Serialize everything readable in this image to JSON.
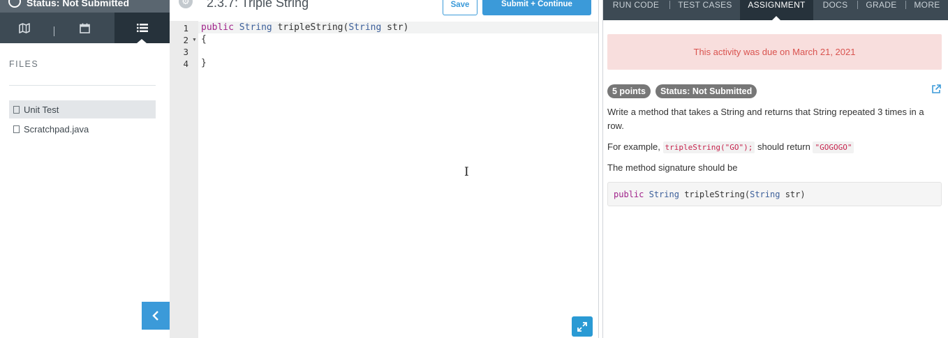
{
  "sidebar": {
    "status_text": "Status: Not Submitted",
    "nav": {
      "map_icon": "map-icon",
      "calendar_icon": "calendar-icon",
      "list_icon": "list-icon"
    },
    "files_label": "FILES",
    "files": [
      {
        "name": "Unit Test",
        "selected": true
      },
      {
        "name": "Scratchpad.java",
        "selected": false
      }
    ],
    "collapse_icon": "chevron-left-icon"
  },
  "editor": {
    "title": "2.3.7: Triple String",
    "save_label": "Save",
    "submit_label": "Submit + Continue",
    "line_numbers": [
      "1",
      "2",
      "3",
      "4"
    ],
    "code": {
      "line1_keyword": "public",
      "line1_type": "String",
      "line1_name": "tripleString(",
      "line1_param_type": "String",
      "line1_rest": "str)",
      "line2": "{",
      "line3": "",
      "line4": "}"
    }
  },
  "panel": {
    "tabs": [
      {
        "label": "RUN CODE",
        "active": false
      },
      {
        "label": "TEST CASES",
        "active": false
      },
      {
        "label": "ASSIGNMENT",
        "active": true
      },
      {
        "label": "DOCS",
        "active": false
      },
      {
        "label": "GRADE",
        "active": false
      },
      {
        "label": "MORE",
        "active": false
      }
    ],
    "alert": "This activity was due on March 21, 2021",
    "points_badge": "5 points",
    "status_badge": "Status: Not Submitted",
    "description": "Write a method that takes a String and returns that String repeated 3 times in a row.",
    "example_prefix": "For example,",
    "example_call": "tripleString(\"GO\");",
    "example_mid": "should return",
    "example_result": "\"GOGOGO\"",
    "signature_intro": "The method signature should be",
    "signature": {
      "keyword": "public",
      "type": "String",
      "name": "tripleString(",
      "param_type": "String",
      "rest": "str)"
    }
  },
  "colors": {
    "accent": "#3b9ad9",
    "nav_bg": "#3d4a54",
    "nav_active": "#26323b",
    "alert_bg": "#f8dedd",
    "alert_text": "#d9534f",
    "badge_bg": "#777777"
  }
}
